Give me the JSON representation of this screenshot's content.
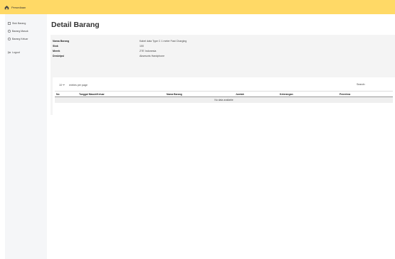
{
  "topbar": {
    "brand": "Persediaan"
  },
  "sidebar": {
    "items": [
      {
        "label": "Stok Barang",
        "icon": "box-icon"
      },
      {
        "label": "Barang Masuk",
        "icon": "download-icon"
      },
      {
        "label": "Barang Keluar",
        "icon": "upload-icon"
      }
    ],
    "logout": {
      "label": "Logout",
      "icon": "logout-icon"
    }
  },
  "page": {
    "title": "Detail Barang"
  },
  "detail": [
    {
      "label": "Nama Barang",
      "value": "Kabel data Type C 1 meter Fast Charging"
    },
    {
      "label": "Stok",
      "value": "100"
    },
    {
      "label": "Merek",
      "value": "ZTE Indonesia"
    },
    {
      "label": "Deskripsi",
      "value": "Aksesoris Handphone"
    }
  ],
  "table": {
    "entries_value": "10",
    "entries_label": "entries per page",
    "search_label": "Search:",
    "columns": [
      "No",
      "Tanggal Masuk/Keluar",
      "Nama Barang",
      "Jumlah",
      "Keterangan",
      "Penerima"
    ],
    "empty_text": "No data available"
  },
  "colors": {
    "topbar": "#ffd966",
    "sidebar": "#f5f6f8",
    "card": "#f4f4f4"
  }
}
